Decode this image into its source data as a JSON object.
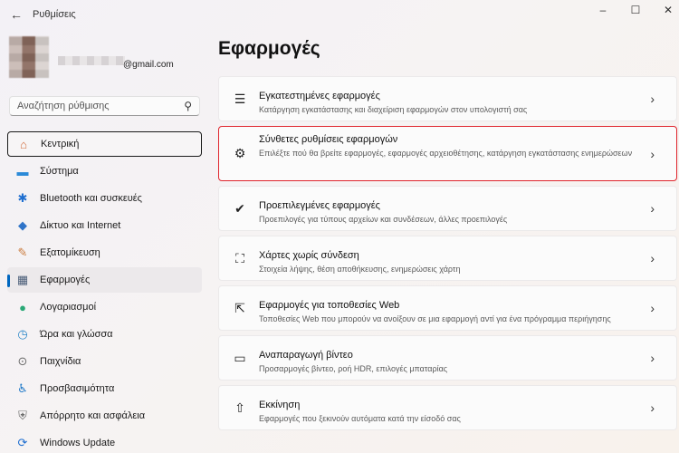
{
  "window": {
    "title": "Ρυθμίσεις",
    "back_icon": "back-arrow-icon",
    "minimize": "–",
    "maximize": "☐",
    "close": "✕"
  },
  "profile": {
    "email_visible_part": "@gmail.com"
  },
  "search": {
    "placeholder": "Αναζήτηση ρύθμισης"
  },
  "sidebar": {
    "items": [
      {
        "label": "Κεντρική",
        "icon": "home-icon",
        "glyph": "⌂"
      },
      {
        "label": "Σύστημα",
        "icon": "monitor-icon",
        "glyph": "▬"
      },
      {
        "label": "Bluetooth και συσκευές",
        "icon": "bluetooth-icon",
        "glyph": "✱"
      },
      {
        "label": "Δίκτυο και Internet",
        "icon": "wifi-icon",
        "glyph": "◆"
      },
      {
        "label": "Εξατομίκευση",
        "icon": "brush-icon",
        "glyph": "✎"
      },
      {
        "label": "Εφαρμογές",
        "icon": "apps-icon",
        "glyph": "▦"
      },
      {
        "label": "Λογαριασμοί",
        "icon": "account-icon",
        "glyph": "●"
      },
      {
        "label": "Ώρα και γλώσσα",
        "icon": "clock-globe-icon",
        "glyph": "◷"
      },
      {
        "label": "Παιχνίδια",
        "icon": "gamepad-icon",
        "glyph": "⊙"
      },
      {
        "label": "Προσβασιμότητα",
        "icon": "accessibility-icon",
        "glyph": "♿"
      },
      {
        "label": "Απόρρητο και ασφάλεια",
        "icon": "shield-icon",
        "glyph": "⛨"
      },
      {
        "label": "Windows Update",
        "icon": "update-icon",
        "glyph": "⟳"
      }
    ]
  },
  "main": {
    "title": "Εφαρμογές",
    "cards": [
      {
        "title": "Εγκατεστημένες εφαρμογές",
        "desc": "Κατάργηση εγκατάστασης και διαχείριση εφαρμογών στον υπολογιστή σας",
        "icon": "list-icon",
        "glyph": "☰"
      },
      {
        "title": "Σύνθετες ρυθμίσεις εφαρμογών",
        "desc": "Επιλέξτε πού θα βρείτε εφαρμογές, εφαρμογές αρχειοθέτησης, κατάργηση εγκατάστασης ενημερώσεων",
        "icon": "app-settings-icon",
        "glyph": "⚙"
      },
      {
        "title": "Προεπιλεγμένες εφαρμογές",
        "desc": "Προεπιλογές για τύπους αρχείων και συνδέσεων, άλλες προεπιλογές",
        "icon": "default-apps-icon",
        "glyph": "✔"
      },
      {
        "title": "Χάρτες χωρίς σύνδεση",
        "desc": "Στοιχεία λήψης, θέση αποθήκευσης, ενημερώσεις χάρτη",
        "icon": "map-icon",
        "glyph": "⛶"
      },
      {
        "title": "Εφαρμογές για τοποθεσίες Web",
        "desc": "Τοποθεσίες Web που μπορούν να ανοίξουν σε μια εφαρμογή αντί για ένα πρόγραμμα περιήγησης",
        "icon": "web-link-icon",
        "glyph": "⇱"
      },
      {
        "title": "Αναπαραγωγή βίντεο",
        "desc": "Προσαρμογές βίντεο, ροή HDR, επιλογές μπαταρίας",
        "icon": "video-icon",
        "glyph": "▭"
      },
      {
        "title": "Εκκίνηση",
        "desc": "Εφαρμογές που ξεκινούν αυτόματα κατά την είσοδό σας",
        "icon": "startup-icon",
        "glyph": "⇧"
      }
    ],
    "chevron": "›"
  },
  "colors": {
    "accent": "#0067c0",
    "highlight_border": "#e0252d"
  }
}
